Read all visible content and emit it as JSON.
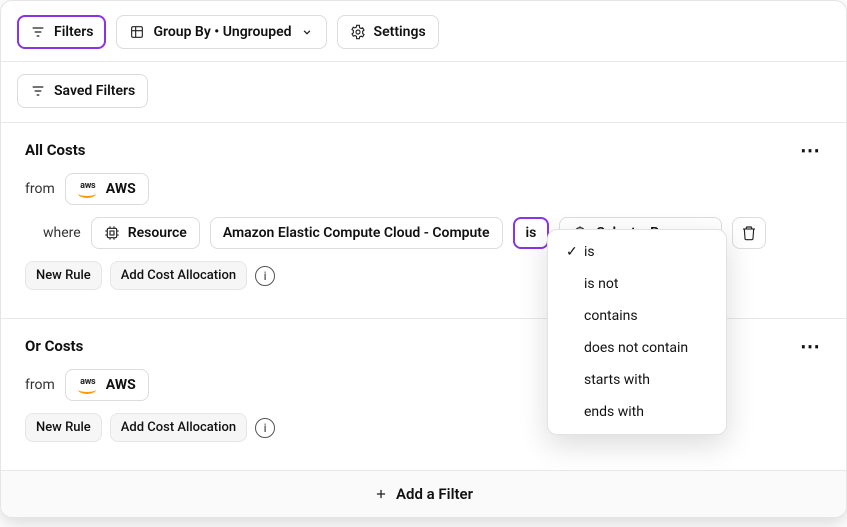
{
  "toolbar": {
    "filters_label": "Filters",
    "groupby_label": "Group By • Ungrouped",
    "settings_label": "Settings"
  },
  "subbar": {
    "saved_filters_label": "Saved Filters"
  },
  "filters": [
    {
      "title": "All Costs",
      "from_label": "from",
      "provider": "AWS",
      "where_label": "where",
      "attribute_label": "Resource",
      "value_label": "Amazon Elastic Compute Cloud - Compute",
      "operator_label": "is",
      "select_resource_label": "Select a Resource",
      "new_rule_label": "New Rule",
      "add_alloc_label": "Add Cost Allocation"
    },
    {
      "title": "Or Costs",
      "from_label": "from",
      "provider": "AWS",
      "new_rule_label": "New Rule",
      "add_alloc_label": "Add Cost Allocation"
    }
  ],
  "operator_dropdown": {
    "selected": "is",
    "options": [
      "is",
      "is not",
      "contains",
      "does not contain",
      "starts with",
      "ends with"
    ]
  },
  "footer": {
    "add_filter_label": "Add a Filter"
  }
}
